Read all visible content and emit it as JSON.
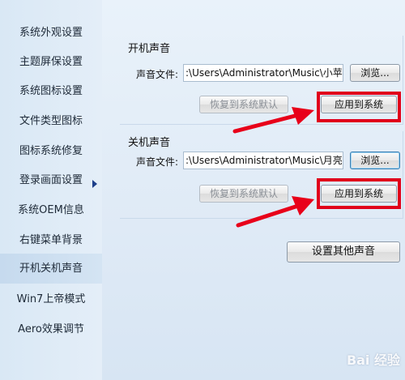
{
  "sidebar": {
    "items": [
      {
        "label": "系统外观设置"
      },
      {
        "label": "主题屏保设置"
      },
      {
        "label": "系统图标设置"
      },
      {
        "label": "文件类型图标"
      },
      {
        "label": "图标系统修复"
      },
      {
        "label": "登录画面设置"
      },
      {
        "label": "系统OEM信息"
      },
      {
        "label": "右键菜单背景"
      },
      {
        "label": "开机关机声音"
      },
      {
        "label": "Win7上帝模式"
      },
      {
        "label": "Aero效果调节"
      }
    ],
    "active_index": 8
  },
  "startup": {
    "title": "开机声音",
    "file_label": "声音文件:",
    "path_value": ":\\Users\\Administrator\\Music\\小苹",
    "browse_label": "浏览...",
    "restore_label": "恢复到系统默认",
    "apply_label": "应用到系统"
  },
  "shutdown": {
    "title": "关机声音",
    "file_label": "声音文件:",
    "path_value": ":\\Users\\Administrator\\Music\\月亮",
    "browse_label": "浏览...",
    "restore_label": "恢复到系统默认",
    "apply_label": "应用到系统"
  },
  "other_sounds_label": "设置其他声音",
  "watermark": {
    "text": "Bai 经验"
  },
  "colors": {
    "highlight": "#e0001b",
    "arrow": "#e8001a"
  }
}
